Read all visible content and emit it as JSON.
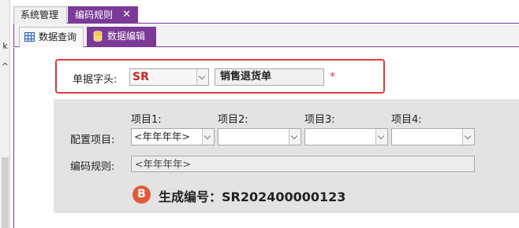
{
  "window": {
    "tabs": [
      {
        "label": "系统管理",
        "active": false
      },
      {
        "label": "编码规则",
        "active": true
      }
    ],
    "close_glyph": "✕"
  },
  "left_strip": {
    "glyphs": [
      "k",
      "^"
    ]
  },
  "sub_tabs": [
    {
      "label": "数据查询",
      "icon": "grid-icon",
      "active": false
    },
    {
      "label": "数据编辑",
      "icon": "database-icon",
      "active": true
    }
  ],
  "header": {
    "label": "单据字头:",
    "code_value": "SR",
    "name_value": "销售退货单",
    "required_mark": "*"
  },
  "config": {
    "item_labels": [
      "项目1:",
      "项目2:",
      "项目3:",
      "项目4:"
    ],
    "row_label": "配置项目:",
    "item_values": [
      "<年年年年>",
      "",
      "",
      ""
    ],
    "rule_label": "编码规则:",
    "rule_value": "<年年年年>"
  },
  "result": {
    "badge": "B",
    "text": "生成编号：SR202400000123"
  },
  "colors": {
    "accent": "#7b3a96",
    "highlight_border": "#e03a3a",
    "required": "#e03a3a",
    "badge": "#e05a3a"
  }
}
